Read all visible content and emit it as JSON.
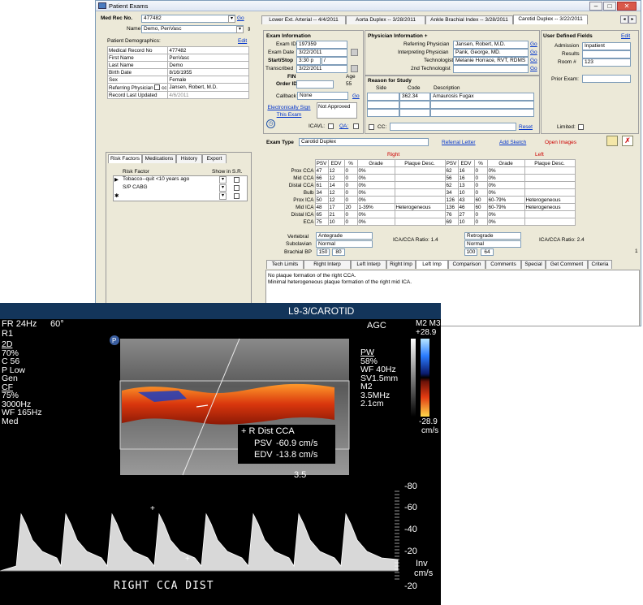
{
  "window": {
    "title": "Patient Exams"
  },
  "header": {
    "med_rec_label": "Med Rec No.",
    "med_rec_value": "477482",
    "go": "Go",
    "name_label": "Name",
    "name_value": "Demo, PenVasc",
    "ext_tabs": [
      "Lower Ext. Arterial -- 4/4/2011",
      "Aorta Duplex -- 3/28/2011",
      "Ankle Brachial Index -- 3/28/2011",
      "Carotid Duplex -- 3/22/2011"
    ]
  },
  "demographics": {
    "title": "Patient Demographics:",
    "edit": "Edit",
    "rows": [
      [
        "Medical Record No",
        "477482"
      ],
      [
        "First Name",
        "PenVasc"
      ],
      [
        "Last Name",
        "Demo"
      ],
      [
        "Birth Date",
        "8/16/1955"
      ],
      [
        "Sex",
        "Female"
      ],
      [
        "Referring Physician",
        "Jansen, Robert, M.D."
      ],
      [
        "Record Last Updated",
        "4/6/2011"
      ]
    ],
    "cc": "cc"
  },
  "left_tabs": [
    "Risk Factors",
    "Medications",
    "History",
    "Export"
  ],
  "risk": {
    "col1": "Risk Factor",
    "col2": "Show in S.R.",
    "rows": [
      "Tobacco--quit <10 years ago",
      "S/P CABG",
      ""
    ]
  },
  "exam_info": {
    "title": "Exam Information",
    "exam_id_label": "Exam ID",
    "exam_id": "197359",
    "exam_date_label": "Exam Date",
    "exam_date": "3/22/2011",
    "startstop_label": "Start/Stop",
    "start": "3:30 p",
    "stop": "/",
    "transcribed_label": "Transcribed",
    "transcribed": "3/22/2011",
    "fin_label": "FIN",
    "order_label": "Order ID",
    "age_label": "Age",
    "age": "55",
    "callback_label": "Callback",
    "callback": "None",
    "go": "Go",
    "esign": "Electronically Sign This Exam",
    "not_approved": "Not Approved",
    "icavl": "ICAVL:",
    "qa": "QA:"
  },
  "physician": {
    "title": "Physician Information +",
    "rows": [
      [
        "Referring Physician",
        "Jansen, Robert, M.D."
      ],
      [
        "Interpreting Physician",
        "Pank, George, MD."
      ],
      [
        "Technologist",
        "Melanie Horrace, RVT, RDMS"
      ],
      [
        "2nd Technologist",
        ""
      ]
    ],
    "go": "Go"
  },
  "reason": {
    "title": "Reason for Study",
    "side": "Side",
    "code": "Code",
    "desc": "Description",
    "code_val": "362.34",
    "desc_val": "Amaurosis Fugax",
    "cc": "CC:",
    "reset": "Reset"
  },
  "user_fields": {
    "title": "User Defined Fields",
    "edit": "Edit",
    "admission_label": "Admission",
    "admission": "Inpatient",
    "results_label": "Results",
    "room_label": "Room #",
    "room": "123",
    "prior_label": "Prior Exam:",
    "limited": "Limited:"
  },
  "exam_type": {
    "label": "Exam Type",
    "value": "Carotid Duplex",
    "referral": "Referral Letter",
    "sketch": "Add Sketch",
    "open_images": "Open Images"
  },
  "measure": {
    "right": "Right",
    "left": "Left",
    "cols": [
      "PSV",
      "EDV",
      "%",
      "Grade",
      "Plaque Desc."
    ],
    "rows": [
      {
        "name": "Prox CCA",
        "r": [
          "47",
          "12",
          "0",
          "0%",
          ""
        ],
        "l": [
          "62",
          "16",
          "0",
          "0%",
          ""
        ]
      },
      {
        "name": "Mid CCA",
        "r": [
          "66",
          "12",
          "0",
          "0%",
          ""
        ],
        "l": [
          "56",
          "16",
          "0",
          "0%",
          ""
        ]
      },
      {
        "name": "Distal CCA",
        "r": [
          "61",
          "14",
          "0",
          "0%",
          ""
        ],
        "l": [
          "62",
          "13",
          "0",
          "0%",
          ""
        ]
      },
      {
        "name": "Bulb",
        "r": [
          "34",
          "12",
          "0",
          "0%",
          ""
        ],
        "l": [
          "34",
          "10",
          "0",
          "0%",
          ""
        ]
      },
      {
        "name": "Prox ICA",
        "r": [
          "50",
          "12",
          "0",
          "0%",
          ""
        ],
        "l": [
          "126",
          "43",
          "60",
          "60-79%",
          "Heterogeneous"
        ]
      },
      {
        "name": "Mid ICA",
        "r": [
          "48",
          "17",
          "20",
          "1-39%",
          "Heterogeneous"
        ],
        "l": [
          "136",
          "46",
          "60",
          "60-79%",
          "Heterogeneous"
        ]
      },
      {
        "name": "Distal ICA",
        "r": [
          "65",
          "21",
          "0",
          "0%",
          ""
        ],
        "l": [
          "76",
          "27",
          "0",
          "0%",
          ""
        ]
      },
      {
        "name": "ECA",
        "r": [
          "75",
          "10",
          "0",
          "0%",
          ""
        ],
        "l": [
          "69",
          "10",
          "0",
          "0%",
          ""
        ]
      }
    ],
    "vertebral_label": "Vertebral",
    "r_vertebral": "Antegrade",
    "l_vertebral": "Retrograde",
    "subclavian_label": "Subclavian",
    "r_subclavian": "Normal",
    "l_subclavian": "Normal",
    "brachial_label": "Brachial BP",
    "r_bp1": "150",
    "r_bp2": "80",
    "l_bp1": "100",
    "l_bp2": "64",
    "r_ratio": "ICA/CCA Ratio:  1.4",
    "l_ratio": "ICA/CCA Ratio:  2.4",
    "page": "1"
  },
  "bottom_tabs": [
    "Tech Limits",
    "Right Interp",
    "Left Interp",
    "Right Imp",
    "Left Imp",
    "Comparison",
    "Comments",
    "Special",
    "Get Comment",
    "Criteria"
  ],
  "notes": [
    "No plaque formation of the right CCA.",
    "Minimal heterogeneous plaque formation of the right mid ICA."
  ],
  "ultrasound": {
    "title": "L9-3/CAROTID",
    "fr": "FR 24Hz",
    "deg": "60°",
    "r1": "R1",
    "agc": "AGC",
    "m2m3": "M2 M3",
    "top_scale": "+28.9",
    "bot_scale": "-28.9",
    "cms": "cm/s",
    "left_params": [
      "2D",
      "70%",
      "C 56",
      "P Low",
      "Gen",
      "CF",
      "75%",
      "3000Hz",
      "WF 165Hz",
      "Med"
    ],
    "pw_params": [
      "PW",
      "58%",
      "WF 40Hz",
      "SV1.5mm",
      "M2",
      "3.5MHz",
      "2.1cm"
    ],
    "meas_title": "+ R Dist CCA",
    "psv_label": "PSV",
    "psv": "-60.9 cm/s",
    "edv_label": "EDV",
    "edv": "-13.8 cm/s",
    "depth": "3.5",
    "scale_ticks": [
      "-80",
      "-60",
      "-40",
      "-20",
      "Inv",
      "cm/s",
      "-20"
    ],
    "caption": "RIGHT CCA DIST"
  }
}
